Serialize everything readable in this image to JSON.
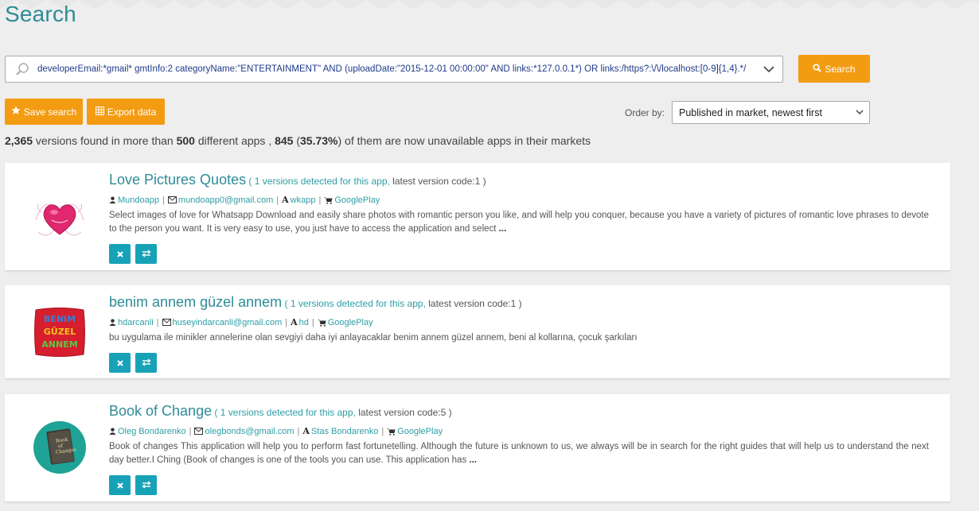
{
  "page": {
    "title": "Search"
  },
  "search": {
    "query": "developerEmail:*gmail* gmtInfo:2 categoryName:\"ENTERTAINMENT\" AND (uploadDate:\"2015-12-01 00:00:00\" AND links:*127.0.0.1*) OR links:/https?:\\/\\/localhost:[0-9]{1,4}.*/",
    "button_label": "Search"
  },
  "toolbar": {
    "save_label": "Save search",
    "export_label": "Export data",
    "order_by_label": "Order by:",
    "order_by_value": "Published in market, newest first"
  },
  "summary": {
    "versions": "2,365",
    "text1": " versions found in more than ",
    "apps": "500",
    "text2": " different apps , ",
    "unavailable": "845",
    "open_paren": " (",
    "percent": "35.73%",
    "text3": ") of them are now unavailable apps in their markets"
  },
  "results": [
    {
      "name": "Love Pictures Quotes",
      "open": " ( ",
      "versions_link": "1 versions detected for this app,",
      "latest": " latest version code:1 )",
      "developer": "Mundoapp",
      "email": "mundoapp0@gmail.com",
      "publisher": "wkapp",
      "market": "GooglePlay",
      "description": "Select images of love for Whatsapp Download and easily share photos with romantic person you like, and will help you conquer, because you have a variety of pictures of romantic love phrases to devote to the person you want. It is very easy to use, you just have to access the application and select",
      "ellipsis": " ...",
      "icon": "heart-icon"
    },
    {
      "name": "benim annem güzel annem",
      "open": " ( ",
      "versions_link": "1 versions detected for this app,",
      "latest": " latest version code:1 )",
      "developer": "hdarcanli",
      "email": "huseyindarcanli@gmail.com",
      "publisher": "hd",
      "market": "GooglePlay",
      "description": "bu uygulama ile minikler annelerine olan sevgiyi daha iyi anlayacaklar benim annem güzel annem, beni al kollarına, çocuk şarkıları",
      "ellipsis": "",
      "icon": "pillow-icon",
      "icon_text": [
        "BENIM",
        "GÜZEL",
        "ANNEM"
      ]
    },
    {
      "name": "Book of Change",
      "open": " ( ",
      "versions_link": "1 versions detected for this app,",
      "latest": " latest version code:5 )",
      "developer": "Oleg Bondarenko",
      "email": "olegbonds@gmail.com",
      "publisher": "Stas Bondarenko",
      "market": "GooglePlay",
      "description": "Book of changes This application will help you to perform fast fortunetelling. Although the future is unknown to us, we always will be in search for the right guides that will help us to understand the next day better.I Ching (Book of changes is one of the tools you can use. This application has",
      "ellipsis": " ...",
      "icon": "book-icon",
      "icon_text": [
        "Book",
        "of",
        "Changes"
      ]
    }
  ],
  "colors": {
    "accent": "#2d8c97",
    "orange": "#f39c12",
    "teal_button": "#17a2b8"
  }
}
